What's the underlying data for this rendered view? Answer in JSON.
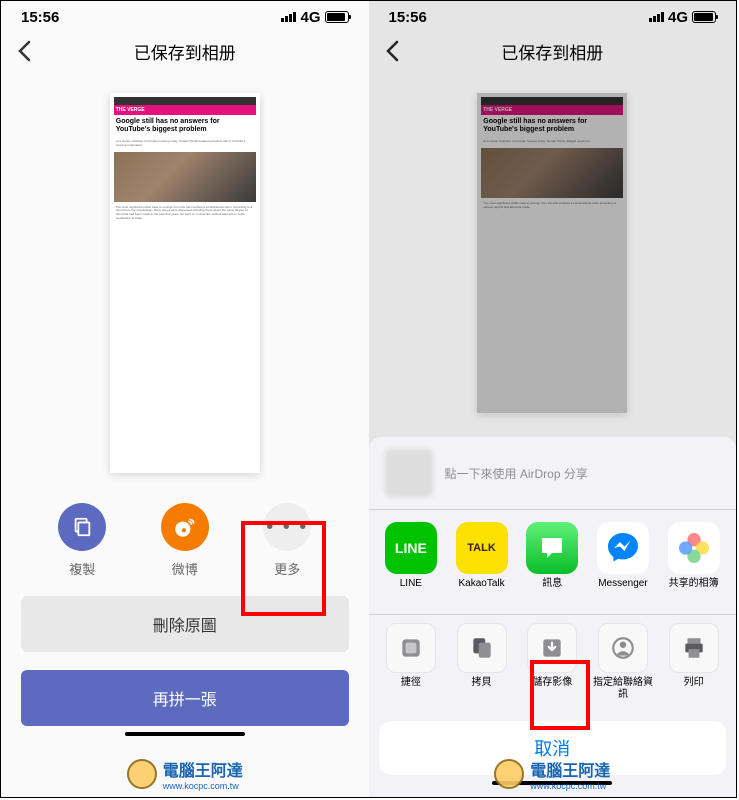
{
  "status": {
    "time": "15:56",
    "network": "4G"
  },
  "header": {
    "title": "已保存到相册"
  },
  "preview": {
    "brand": "THE VERGE",
    "headline": "Google still has no answers for YouTube's biggest problem"
  },
  "share": {
    "copy": "複製",
    "weibo": "微博",
    "more": "更多"
  },
  "buttons": {
    "delete": "刪除原圖",
    "again": "再拼一張"
  },
  "sheet": {
    "airdrop": "點一下來使用 AirDrop 分享",
    "apps": [
      {
        "id": "line",
        "label": "LINE"
      },
      {
        "id": "kakao",
        "label": "KakaoTalk"
      },
      {
        "id": "messages",
        "label": "訊息"
      },
      {
        "id": "messenger",
        "label": "Messenger"
      },
      {
        "id": "photos",
        "label": "共享的相簿"
      }
    ],
    "actions": [
      {
        "id": "shortcuts",
        "label": "捷徑"
      },
      {
        "id": "copy",
        "label": "拷貝"
      },
      {
        "id": "save-image",
        "label": "儲存影像"
      },
      {
        "id": "assign-contact",
        "label": "指定給聯絡資訊"
      },
      {
        "id": "print",
        "label": "列印"
      }
    ],
    "cancel": "取消"
  },
  "watermark": {
    "text": "電腦王阿達",
    "url": "www.kocpc.com.tw"
  }
}
